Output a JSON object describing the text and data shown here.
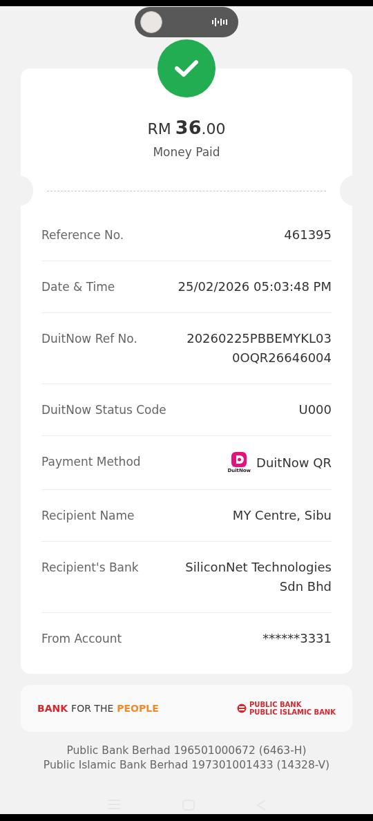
{
  "receipt": {
    "currency": "RM",
    "amount_main": "36",
    "amount_decimals": ".00",
    "caption": "Money Paid"
  },
  "details": [
    {
      "label": "Reference No.",
      "value": [
        "461395"
      ]
    },
    {
      "label": "Date & Time",
      "value": [
        "25/02/2026 05:03:48 PM"
      ]
    },
    {
      "label": "DuitNow Ref No.",
      "value": [
        "20260225PBBEMYKL03",
        "0OQR26646004"
      ]
    },
    {
      "label": "DuitNow Status Code",
      "value": [
        "U000"
      ]
    },
    {
      "label": "Payment Method",
      "value": [
        "DuitNow QR"
      ],
      "logo_text": "DuitNow"
    },
    {
      "label": "Recipient Name",
      "value": [
        "MY Centre, Sibu"
      ]
    },
    {
      "label": "Recipient's Bank",
      "value": [
        "SiliconNet Technologies",
        "Sdn Bhd"
      ]
    },
    {
      "label": "From Account",
      "value": [
        "******3331"
      ]
    }
  ],
  "banner": {
    "tagline": [
      {
        "text": "BANK",
        "color": "#d7262e"
      },
      {
        "text": "FOR THE",
        "color": "#3a3a3a"
      },
      {
        "text": "PEOPLE",
        "color": "#f08a2c"
      }
    ],
    "logo_lines": [
      "PUBLIC BANK",
      "PUBLIC ISLAMIC BANK"
    ]
  },
  "footer": [
    "Public Bank Berhad 196501000672 (6463-H)",
    "Public Islamic Bank Berhad 197301001433 (14328-V)"
  ]
}
